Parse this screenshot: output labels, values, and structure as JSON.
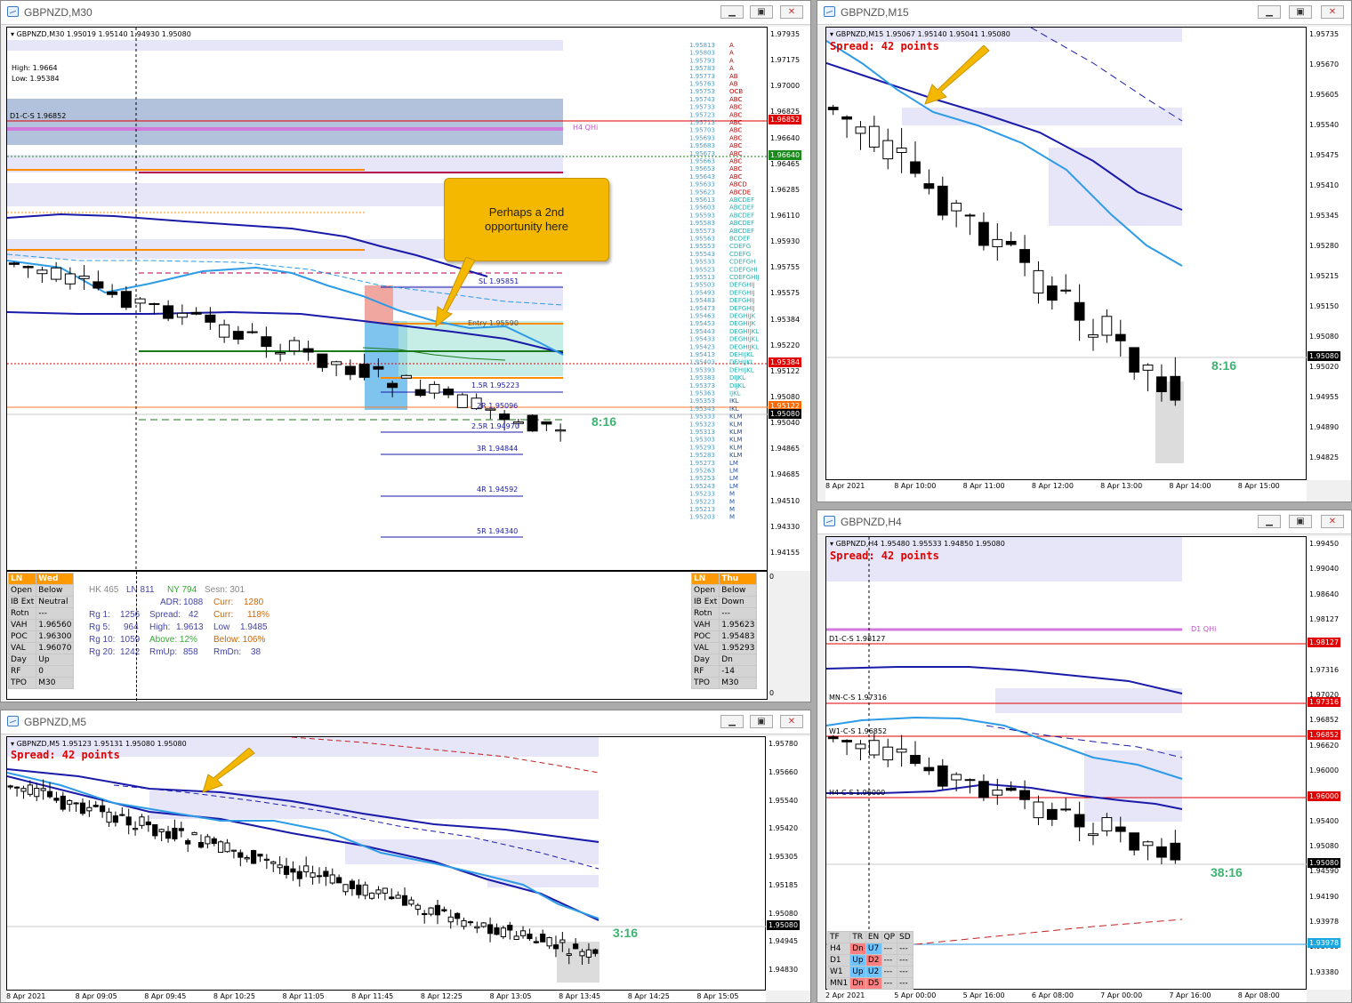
{
  "m30": {
    "title": "GBPNZD,M30",
    "header": "GBPNZD,M30  1.95019 1.95140 1.94930 1.95080",
    "high": "High: 1.9664",
    "low": "Low: 1.95384",
    "d1cs": "D1-C-S 1.96852",
    "h4qhi": "H4 QHi",
    "sl": "SL 1.95851",
    "entry": "Entry 1.95590",
    "r15": "1.5R 1.95223",
    "r2": "2R 1.95096",
    "r25": "2.5R 1.94970",
    "r3": "3R 1.94844",
    "r4": "4R 1.94592",
    "r5": "5R 1.94340",
    "timer": "8:16",
    "callout": "Perhaps a 2nd opportunity here",
    "yticks": [
      "1.97935",
      "1.97175",
      "1.97000",
      "1.96825",
      "1.96640",
      "1.96465",
      "1.96285",
      "1.96110",
      "1.95930",
      "1.95755",
      "1.95575",
      "1.95384",
      "1.95220",
      "1.95122",
      "1.95080",
      "1.95040",
      "1.94865",
      "1.94685",
      "1.94510",
      "1.94330",
      "1.94155"
    ],
    "price_tags": {
      "t1": "1.96852",
      "t2": "1.96640",
      "t3": "1.95384",
      "t4": "1.95122",
      "t5": "1.95080"
    }
  },
  "m30_panel": {
    "left": {
      "hdr": [
        "LN",
        "Wed"
      ],
      "rows": [
        [
          "Open",
          "Below"
        ],
        [
          "IB Ext",
          "Neutral"
        ],
        [
          "Rotn",
          "---"
        ],
        [
          "VAH",
          "1.96560"
        ],
        [
          "POC",
          "1.96300"
        ],
        [
          "VAL",
          "1.96070"
        ],
        [
          "Day",
          "Up"
        ],
        [
          "RF",
          "0"
        ],
        [
          "TPO",
          "M30"
        ]
      ]
    },
    "right": {
      "hdr": [
        "LN",
        "Thu"
      ],
      "rows": [
        [
          "Open",
          "Below"
        ],
        [
          "IB Ext",
          "Down"
        ],
        [
          "Rotn",
          "---"
        ],
        [
          "VAH",
          "1.95623"
        ],
        [
          "POC",
          "1.95483"
        ],
        [
          "VAL",
          "1.95293"
        ],
        [
          "Day",
          "Dn"
        ],
        [
          "RF",
          "-14"
        ],
        [
          "TPO",
          "M30"
        ]
      ]
    },
    "sessions": {
      "hk": "HK 465",
      "ln": "LN 811",
      "ny": "NY 794",
      "sesn": "Sesn: 301"
    },
    "adr": "ADR:",
    "adr_v": "1088",
    "curr1": "Curr:",
    "curr1_v": "1280",
    "rg1": "Rg 1:",
    "rg1_v": "1256",
    "spread": "Spread:",
    "spread_v": "42",
    "curr2": "Curr:",
    "curr2_v": "118%",
    "rg5": "Rg 5:",
    "rg5_v": "964",
    "high": "High:",
    "high_v": "1.9613",
    "low": "Low",
    "low_v": "1.9485",
    "rg10": "Rg 10:",
    "rg10_v": "1059",
    "above": "Above: 12%",
    "below": "Below: 106%",
    "rg20": "Rg 20:",
    "rg20_v": "1242",
    "rmup": "RmUp:",
    "rmup_v": "858",
    "rmdn": "RmDn:",
    "rmdn_v": "38",
    "axis0a": "0",
    "axis0b": "0"
  },
  "m15": {
    "title": "GBPNZD,M15",
    "header": "GBPNZD,M15  1.95067 1.95140 1.95041 1.95080",
    "spread": "Spread: 42 points",
    "timer": "8:16",
    "yticks": [
      "1.95735",
      "1.95670",
      "1.95605",
      "1.95540",
      "1.95475",
      "1.95410",
      "1.95345",
      "1.95280",
      "1.95215",
      "1.95150",
      "1.95080",
      "1.95020",
      "1.94955",
      "1.94890",
      "1.94825"
    ],
    "xticks": [
      "8 Apr 2021",
      "8 Apr 10:00",
      "8 Apr 11:00",
      "8 Apr 12:00",
      "8 Apr 13:00",
      "8 Apr 14:00",
      "8 Apr 15:00"
    ],
    "price_tag": "1.95080"
  },
  "m5": {
    "title": "GBPNZD,M5",
    "header": "GBPNZD,M5  1.95123 1.95131 1.95080 1.95080",
    "spread": "Spread: 42 points",
    "timer": "3:16",
    "yticks": [
      "1.95780",
      "1.95660",
      "1.95540",
      "1.95420",
      "1.95305",
      "1.95185",
      "1.95080",
      "1.94945",
      "1.94830"
    ],
    "xticks": [
      "8 Apr 2021",
      "8 Apr 09:05",
      "8 Apr 09:45",
      "8 Apr 10:25",
      "8 Apr 11:05",
      "8 Apr 11:45",
      "8 Apr 12:25",
      "8 Apr 13:05",
      "8 Apr 13:45",
      "8 Apr 14:25",
      "8 Apr 15:05"
    ],
    "price_tag": "1.95080"
  },
  "h4": {
    "title": "GBPNZD,H4",
    "header": "GBPNZD,H4  1.95480 1.95533 1.94850 1.95080",
    "spread": "Spread: 42 points",
    "timer": "38:16",
    "d1qhi": "D1 QHi",
    "d1cs": "D1-C-S 1.98127",
    "mncs": "MN-C-S 1.97316",
    "w1cs": "W1-C-S 1.96852",
    "h4cs": "H4-C-S 1.96000",
    "yticks": [
      "1.99450",
      "1.99040",
      "1.98640",
      "1.98127",
      "1.97430",
      "1.97316",
      "1.97020",
      "1.96852",
      "1.96620",
      "1.96000",
      "1.95810",
      "1.95400",
      "1.95080",
      "1.94590",
      "1.94190",
      "1.93978",
      "1.93780",
      "1.93380"
    ],
    "xticks": [
      "2 Apr 2021",
      "5 Apr 00:00",
      "5 Apr 16:00",
      "6 Apr 08:00",
      "7 Apr 00:00",
      "7 Apr 16:00",
      "8 Apr 08:00"
    ],
    "tags": {
      "a": "1.98127",
      "b": "1.97316",
      "c": "1.96852",
      "d": "1.96000",
      "e": "1.95080",
      "f": "1.93978"
    },
    "tf_table": {
      "head": [
        "TF",
        "TR",
        "EN",
        "QP",
        "SD"
      ],
      "rows": [
        [
          "H4",
          "Dn",
          "U7",
          "---",
          "---"
        ],
        [
          "D1",
          "Up",
          "D2",
          "---",
          "---"
        ],
        [
          "W1",
          "Up",
          "U2",
          "---",
          "---"
        ],
        [
          "MN1",
          "Dn",
          "D5",
          "---",
          "---"
        ]
      ]
    }
  },
  "colors": {
    "bull": "#ffffff",
    "bear": "#000000",
    "ma_dark": "#1a1aa8",
    "ma_light": "#2d9be6",
    "zone": "#e6e6f8",
    "price_red": "#e00000",
    "timer": "#3cb371"
  }
}
